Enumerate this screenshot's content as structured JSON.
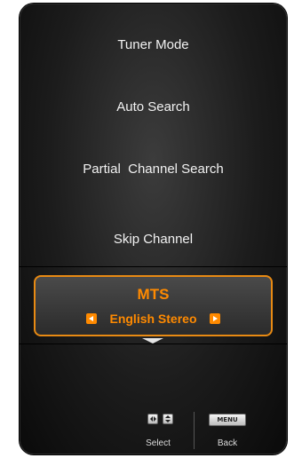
{
  "menu": {
    "items": [
      {
        "label": "Tuner Mode"
      },
      {
        "label": "Auto Search"
      },
      {
        "label": "Partial  Channel Search"
      },
      {
        "label": "Skip Channel"
      }
    ],
    "selected": {
      "title": "MTS",
      "value": "English Stereo"
    }
  },
  "hints": {
    "select_label": "Select",
    "back_label": "Back",
    "menu_key_label": "MENU"
  },
  "colors": {
    "accent": "#ff8a00",
    "border_accent": "#e88a13",
    "panel": "#1c1c1c"
  },
  "icons": {
    "left_arrow": "left-arrow-icon",
    "right_arrow": "right-arrow-icon",
    "scroll_down": "down-arrow-icon",
    "left_right_key": "left-right-key-icon",
    "up_down_key": "up-down-key-icon",
    "menu_key": "menu-key-icon"
  }
}
